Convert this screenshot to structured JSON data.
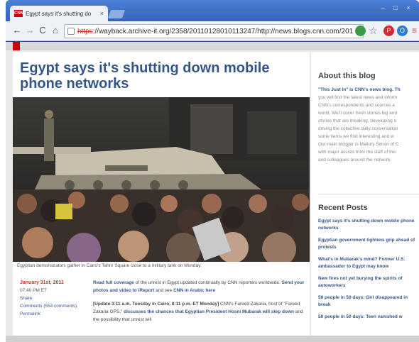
{
  "browser": {
    "tab_title": "Egypt says it's shutting do",
    "tab_close": "×",
    "favicon_text": "CNN",
    "url_scheme": "https",
    "url": "://wayback.archive-it.org/2358/20110128010113247/http://news.blogs.cnn.com/201",
    "icons": [
      "back-icon",
      "forward-icon",
      "reload-icon",
      "home-icon",
      "lock-icon",
      "star-icon",
      "menu-icon"
    ]
  },
  "article": {
    "headline": "Egypt says it's shutting down mobile phone networks",
    "caption": "Egyptian demonstrators gather in Cairo's Tahrir Square close to a military tank on Monday.",
    "date": "January 31st, 2011",
    "time": "07:40 PM ET",
    "share": "Share",
    "comments": "Comments (554 comments)",
    "permalink": "Permalink",
    "para1_lead": "Read full coverage",
    "para1_mid": " of the unrest in Egypt updated continually by CNN reporters worldwide. ",
    "para1_link2": "Send your photos and video to iReport",
    "para1_mid2": " and see ",
    "para1_link3": "CNN in Arabic here",
    "para2_lead": "[Update 3:11 a.m. Tuesday in Cairo, 8:11 p.m. ET Monday]",
    "para2_mid": " CNN's Fareed Zakaria, host of \"Fareed Zakaria GPS,\" ",
    "para2_link": "discusses the chances that Egyptian President Hosni Mubarak will step down",
    "para2_end": " and the possibility that unrest will"
  },
  "sidebar": {
    "about_title": "About this blog",
    "about_lines": [
      "\"This Just In\" is CNN's news blog. Th",
      "you will find the latest news and inform",
      "CNN's correspondents and sources a",
      "world. We'll cover fresh stories big and",
      "stories that are breaking, developing o",
      "driving the collective daily conversation",
      "some items we find interesting and w",
      "Our main blogger is Mallory Simon of C",
      "with major assists from the staff of the",
      "and colleagues around the network."
    ],
    "recent_title": "Recent Posts",
    "recent_posts": [
      "Egypt says it's shutting down mobile phone networks",
      "Egyptian government tightens grip ahead of protests",
      "What's in Mubarak's mind? Former U.S. ambassador to Egypt may know",
      "New fires not yet burying the spirits of autoworkers",
      "50 people in 50 days: Girl disappeared in break",
      "50 people in 50 days: Teen vanished w"
    ]
  },
  "colors": {
    "headline": "#34558b",
    "date": "#c0392b",
    "chrome": "#3565b8"
  }
}
